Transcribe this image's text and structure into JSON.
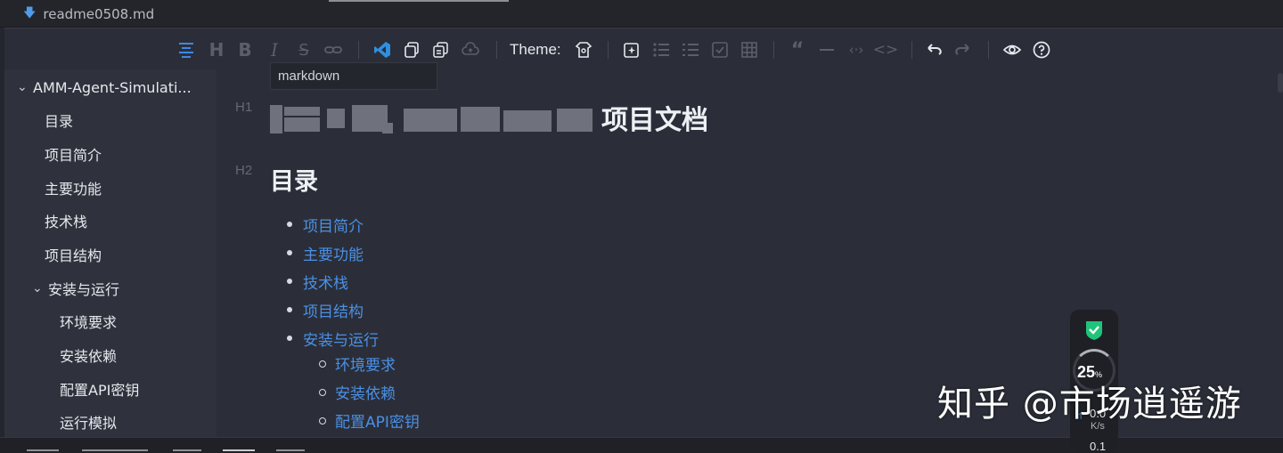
{
  "file_tab": {
    "name": "readme0508.md",
    "icon": "download-arrow-icon"
  },
  "toolbar": {
    "theme_label": "Theme:",
    "tooltip": "markdown",
    "icons": [
      "align-center-icon",
      "heading-icon",
      "bold-icon",
      "italic-icon",
      "strikethrough-icon",
      "link-icon",
      "vscode-icon",
      "copy-icon",
      "copy-html-icon",
      "cloud-upload-icon",
      "theme-icon",
      "ai-spark-icon",
      "bullet-list-icon",
      "ordered-list-icon",
      "checkbox-icon",
      "table-icon",
      "quote-icon",
      "hr-icon",
      "inline-code-icon",
      "code-block-icon",
      "undo-icon",
      "redo-icon",
      "preview-eye-icon",
      "help-icon"
    ]
  },
  "outline": {
    "root": "AMM-Agent-Simulati...",
    "items": [
      "目录",
      "项目简介",
      "主要功能",
      "技术栈",
      "项目结构"
    ],
    "group": "安装与运行",
    "sub_items": [
      "环境要求",
      "安装依赖",
      "配置API密钥",
      "运行模拟"
    ]
  },
  "content": {
    "h1_marker": "H1",
    "h1_title": "项目文档",
    "h2_marker": "H2",
    "h2_title": "目录",
    "toc": [
      "项目简介",
      "主要功能",
      "技术栈",
      "项目结构",
      "安装与运行"
    ],
    "toc_sub": [
      "环境要求",
      "安装依赖",
      "配置API密钥"
    ]
  },
  "monitor": {
    "cpu_percent": "25",
    "percent_sign": "%",
    "net_up": "0.0",
    "net_unit": "K/s",
    "net_down": "0.1"
  },
  "watermark": "知乎 @市场逍遥游",
  "colors": {
    "link": "#4a90e6",
    "accent": "#3f88e6",
    "bg": "#2b2e38",
    "sidebar": "#2f323c"
  }
}
